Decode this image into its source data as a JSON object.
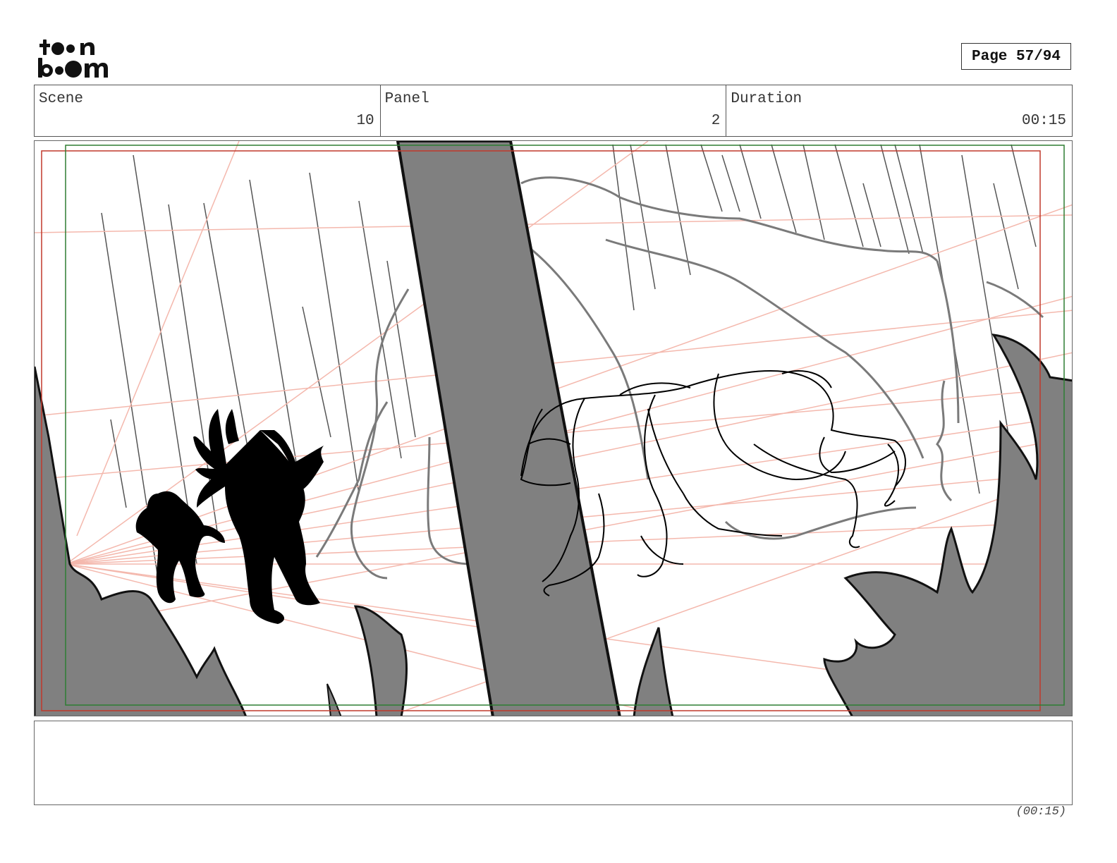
{
  "logo": {
    "line1": "toon",
    "line2": "boom",
    "icon": "toon-boom-logo"
  },
  "page_label": "Page 57/94",
  "header": {
    "scene": {
      "label": "Scene",
      "value": "10"
    },
    "panel": {
      "label": "Panel",
      "value": "2"
    },
    "duration": {
      "label": "Duration",
      "value": "00:15"
    }
  },
  "panel_image": {
    "description_icon": "storyboard-sketch-image"
  },
  "notes": "",
  "footer": {
    "duration": "(00:15)"
  }
}
